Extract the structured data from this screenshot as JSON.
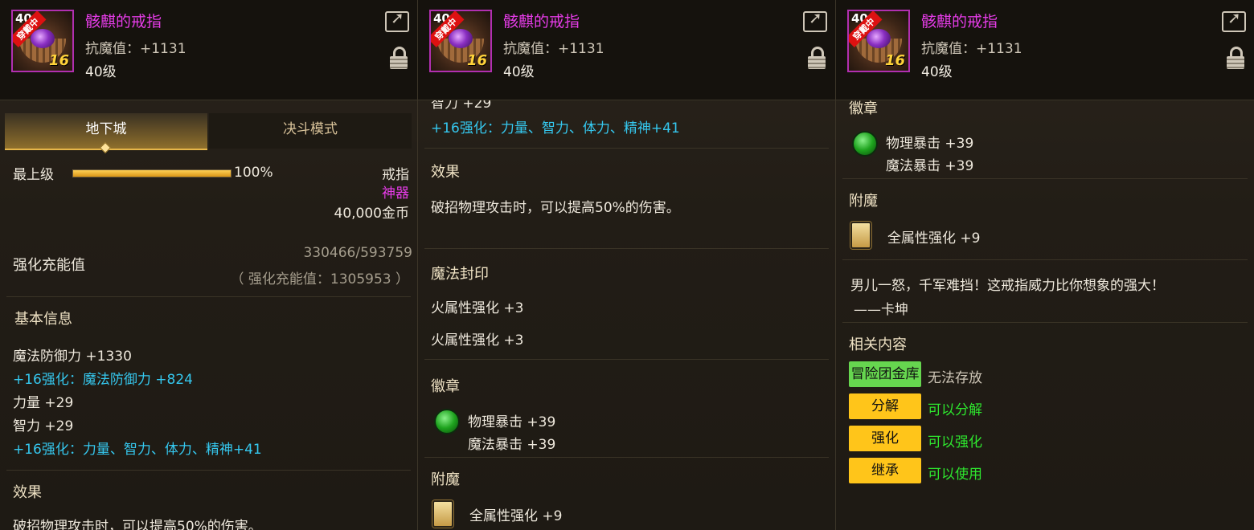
{
  "header": {
    "item_name": "骸麒的戒指",
    "resist_text": "抗魔值：+1131",
    "level_text": "40级",
    "icon_level": "40",
    "equipped_tag": "穿戴中",
    "reinforce_level": "16",
    "rarity_color": "#e63ce8"
  },
  "tabs": {
    "active": "地下城",
    "inactive": "决斗模式"
  },
  "info": {
    "max_level_label": "最上级",
    "max_level_percent": "100%",
    "progress_fraction": 1.0,
    "slot": "戒指",
    "rarity": "神器",
    "price": "40,000金币"
  },
  "charge": {
    "label": "强化充能值",
    "value": "330466/593759",
    "total": "（ 强化充能值：1305953 ）"
  },
  "basic": {
    "title": "基本信息",
    "lines": {
      "mdef": "魔法防御力 +1330",
      "enh1": "+16强化：魔法防御力 +824",
      "str": "力量 +29",
      "int": "智力 +29",
      "enh2": "+16强化：力量、智力、体力、精神+41",
      "int_cut": "智力 +29"
    }
  },
  "effect": {
    "title": "效果",
    "text": "破招物理攻击时，可以提高50%的伤害。",
    "text_cut": "破招物理攻击时，可以提高50%的伤害。"
  },
  "seal": {
    "title": "魔法封印",
    "line1": "火属性强化 +3",
    "line2": "火属性强化 +3"
  },
  "emblem": {
    "title": "徽章",
    "line1": "物理暴击 +39",
    "line2": "魔法暴击 +39"
  },
  "enchant": {
    "title": "附魔",
    "line": "全属性强化 +9"
  },
  "flavor": {
    "quote": "男儿一怒，千军难挡！这戒指威力比你想象的强大！",
    "author": "——卡坤"
  },
  "related": {
    "title": "相关内容",
    "items": [
      {
        "badge": "冒险团金库",
        "status": "无法存放"
      },
      {
        "badge": "分解",
        "status": "可以分解"
      },
      {
        "badge": "强化",
        "status": "可以强化"
      },
      {
        "badge": "继承",
        "status": "可以使用"
      }
    ]
  },
  "icons": [
    "share-icon",
    "lock-icon",
    "emblem-icon",
    "enchant-card-icon"
  ]
}
